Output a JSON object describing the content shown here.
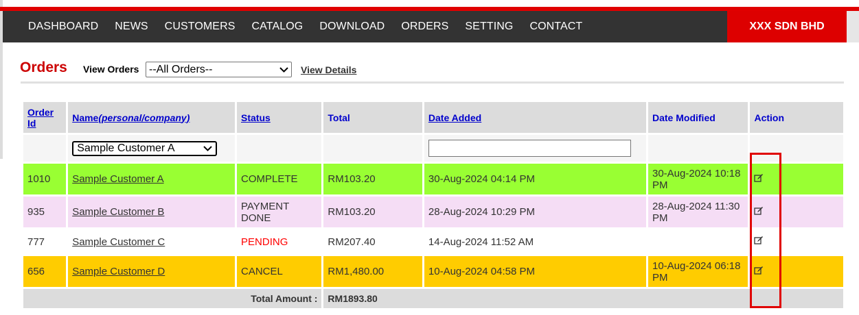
{
  "nav": {
    "items": [
      "DASHBOARD",
      "NEWS",
      "CUSTOMERS",
      "CATALOG",
      "DOWNLOAD",
      "ORDERS",
      "SETTING",
      "CONTACT"
    ],
    "brand": "XXX SDN BHD"
  },
  "page": {
    "title": "Orders",
    "view_label": "View Orders",
    "view_selected": "--All Orders--",
    "view_details": "View Details"
  },
  "table": {
    "headers": {
      "order_id": "Order Id",
      "name_prefix": "Name",
      "name_suffix": "(personal/company)",
      "status": "Status",
      "total": "Total",
      "date_added": "Date Added",
      "date_modified": "Date Modified",
      "action": "Action"
    },
    "filter": {
      "customer_selected": "Sample Customer A",
      "date_added_value": ""
    },
    "rows": [
      {
        "id": "1010",
        "name": "Sample Customer A",
        "status": "COMPLETE",
        "total": "RM103.20",
        "date_added": "30-Aug-2024 04:14 PM",
        "date_modified": "30-Aug-2024 10:18 PM"
      },
      {
        "id": "935",
        "name": "Sample Customer B",
        "status": "PAYMENT DONE",
        "total": "RM103.20",
        "date_added": "28-Aug-2024 10:29 PM",
        "date_modified": "28-Aug-2024 11:30 PM"
      },
      {
        "id": "777",
        "name": "Sample Customer C",
        "status": "PENDING",
        "total": "RM207.40",
        "date_added": "14-Aug-2024 11:52 AM",
        "date_modified": ""
      },
      {
        "id": "656",
        "name": "Sample Customer D",
        "status": "CANCEL",
        "total": "RM1,480.00",
        "date_added": "10-Aug-2024 04:58 PM",
        "date_modified": "10-Aug-2024 06:18 PM"
      }
    ],
    "total_label": "Total Amount :",
    "total_value": "RM1893.80"
  },
  "colors": {
    "accent_red": "#e00000",
    "complete_row": "#99ff33",
    "payment_row": "#f5ddf5",
    "cancel_row": "#ffcc00",
    "pending_text": "#ff0000"
  }
}
